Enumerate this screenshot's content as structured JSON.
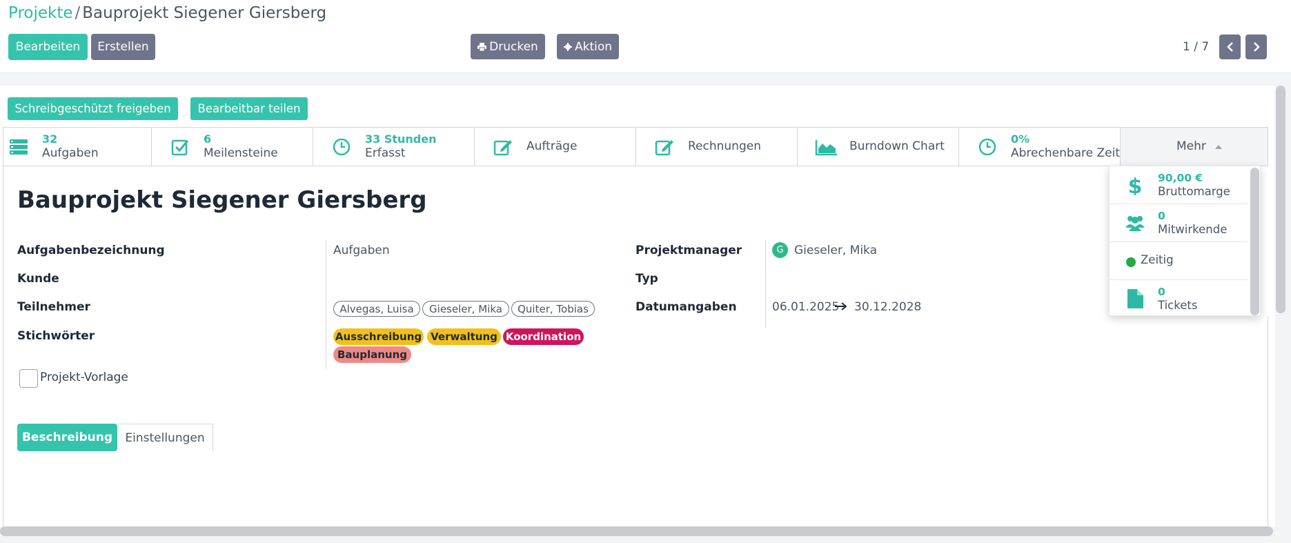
{
  "breadcrumb": {
    "parent": "Projekte",
    "separator": "/",
    "current": "Bauprojekt Siegener Giersberg"
  },
  "toolbar": {
    "edit_label": "Bearbeiten",
    "create_label": "Erstellen",
    "print_label": "Drucken",
    "action_label": "Aktion"
  },
  "pager": {
    "value": "1 / 7"
  },
  "share": {
    "readonly_label": "Schreibgeschützt freigeben",
    "editable_label": "Bearbeitbar teilen"
  },
  "stats": [
    {
      "value": "32",
      "label": "Aufgaben",
      "icon": "tasks-icon"
    },
    {
      "value": "6",
      "label": "Meilensteine",
      "icon": "check-square-icon"
    },
    {
      "value": "33 Stunden",
      "label": "Erfasst",
      "icon": "clock-icon"
    },
    {
      "label": "Aufträge",
      "icon": "edit-icon"
    },
    {
      "label": "Rechnungen",
      "icon": "edit-icon"
    },
    {
      "label": "Burndown Chart",
      "icon": "area-chart-icon"
    },
    {
      "value": "0%",
      "label": "Abrechenbare Zeit",
      "icon": "clock-icon"
    }
  ],
  "more": {
    "label": "Mehr"
  },
  "dropdown": {
    "margin": {
      "value": "90,00 €",
      "label": "Bruttomarge",
      "icon": "dollar-icon"
    },
    "collaborators": {
      "value": "0",
      "label": "Mitwirkende",
      "icon": "users-icon"
    },
    "status": {
      "label": "Zeitig",
      "color": "#28a745"
    },
    "tickets": {
      "value": "0",
      "label": "Tickets",
      "icon": "file-icon"
    }
  },
  "record": {
    "title": "Bauprojekt Siegener Giersberg",
    "fields": {
      "task_label_name": "Aufgabenbezeichnung",
      "task_label_value": "Aufgaben",
      "customer_name": "Kunde",
      "participants_name": "Teilnehmer",
      "participants": [
        "Alvegas, Luisa",
        "Gieseler, Mika",
        "Quiter, Tobias"
      ],
      "tags_name": "Stichwörter",
      "tags": [
        {
          "label": "Ausschreibung",
          "bg": "#f2c018",
          "fg": "#1f2937"
        },
        {
          "label": "Verwaltung",
          "bg": "#f2c018",
          "fg": "#1f2937"
        },
        {
          "label": "Koordination",
          "bg": "#d1145a",
          "fg": "#ffffff"
        },
        {
          "label": "Bauplanung",
          "bg": "#ee8a86",
          "fg": "#1f2937"
        }
      ],
      "manager_name": "Projektmanager",
      "manager_initial": "G",
      "manager_value": "Gieseler, Mika",
      "type_name": "Typ",
      "dates_name": "Datumangaben",
      "date_start": "06.01.2025",
      "date_end": "30.12.2028",
      "template_label": "Projekt-Vorlage"
    }
  },
  "tabs": {
    "description": "Beschreibung",
    "settings": "Einstellungen"
  },
  "colors": {
    "accent": "#35c4ab",
    "secondary_button": "#70748a"
  }
}
